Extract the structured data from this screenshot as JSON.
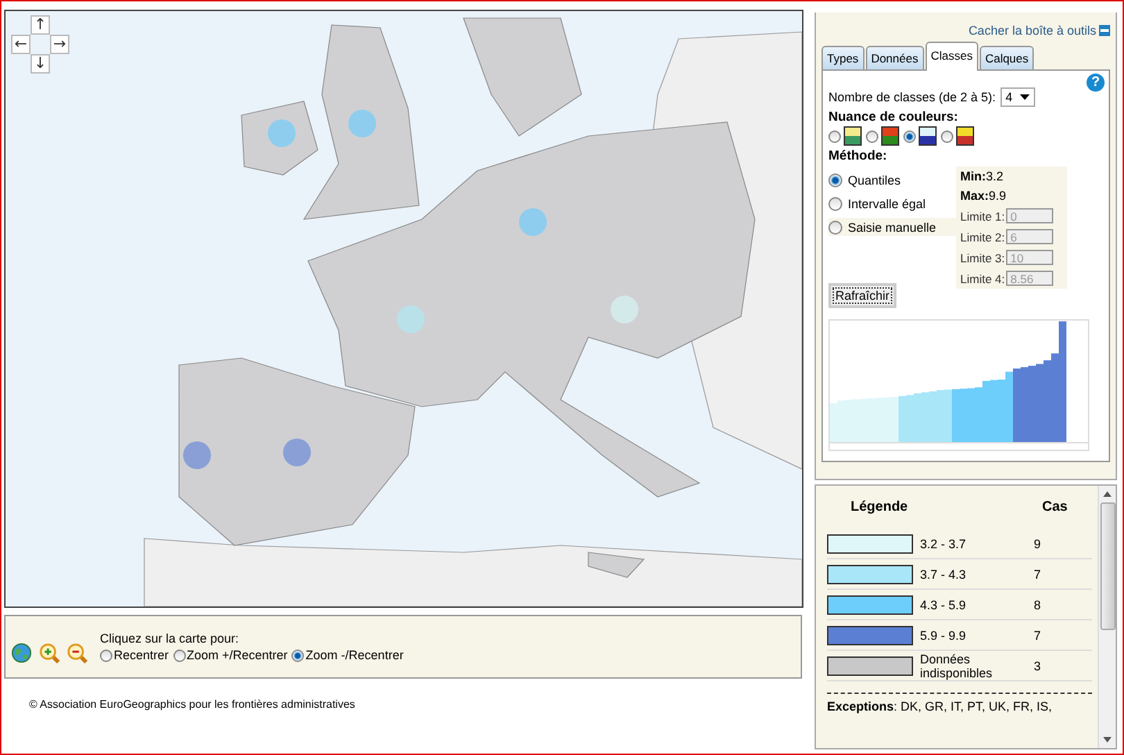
{
  "map": {
    "pan_buttons": [
      "↑",
      "←",
      "→",
      "↓"
    ]
  },
  "map_tools": {
    "label": "Cliquez sur la carte pour:",
    "options": [
      {
        "label": "Recentrer",
        "selected": false
      },
      {
        "label": "Zoom +/Recentrer",
        "selected": false
      },
      {
        "label": "Zoom -/Recentrer",
        "selected": true
      }
    ]
  },
  "copyright": "© Association EuroGeographics pour les frontières administratives",
  "toolbox": {
    "hide_link": "Cacher la boîte à outils",
    "tabs": [
      {
        "label": "Types",
        "selected": false
      },
      {
        "label": "Données",
        "selected": false
      },
      {
        "label": "Classes",
        "selected": true
      },
      {
        "label": "Calques",
        "selected": false
      }
    ],
    "help": "?",
    "classes_label": "Nombre de classes (de 2 à 5):",
    "classes_value": "4",
    "palette_label": "Nuance de couleurs:",
    "palettes": [
      {
        "selected": false,
        "bands": [
          {
            "color": "#f5ea8c"
          },
          {
            "color": "#3a9a60"
          }
        ]
      },
      {
        "selected": false,
        "bands": [
          {
            "color": "#e0401a"
          },
          {
            "color": "#2d8a1e"
          }
        ]
      },
      {
        "selected": true,
        "bands": [
          {
            "color": "#dff3f8"
          },
          {
            "color": "#2a32a8"
          }
        ]
      },
      {
        "selected": false,
        "bands": [
          {
            "color": "#f2dc2a"
          },
          {
            "color": "#c8302c"
          }
        ]
      }
    ],
    "method_label": "Méthode:",
    "methods": [
      {
        "label": "Quantiles",
        "selected": true
      },
      {
        "label": "Intervalle égal",
        "selected": false
      },
      {
        "label": "Saisie manuelle",
        "selected": false
      }
    ],
    "stats": [
      "**Min:**3.2",
      "**Max:**9.9"
    ],
    "limits": [
      {
        "label": "Limite 1:",
        "value": "0"
      },
      {
        "label": "Limite 2:",
        "value": "6"
      },
      {
        "label": "Limite 3:",
        "value": "10"
      },
      {
        "label": "Limite 4:",
        "value": "8.56"
      }
    ],
    "refresh": "Rafraîchir"
  },
  "legend": {
    "title": "Légende",
    "count_header": "Cas",
    "rows": [
      {
        "label": "3.2 - 3.7",
        "count": "9",
        "color": "#e0f7fa"
      },
      {
        "label": "3.7 - 4.3",
        "count": "7",
        "color": "#a8e6f8"
      },
      {
        "label": "4.3 - 5.9",
        "count": "8",
        "color": "#6dcdfb"
      },
      {
        "label": "5.9 - 9.9",
        "count": "7",
        "color": "#5b7fd3"
      },
      {
        "label": "Données indisponibles",
        "count": "3",
        "color": "#c8c8c8"
      }
    ],
    "exceptions": "**Exceptions**: DK, GR, IT, PT, UK, FR, IS,"
  }
}
